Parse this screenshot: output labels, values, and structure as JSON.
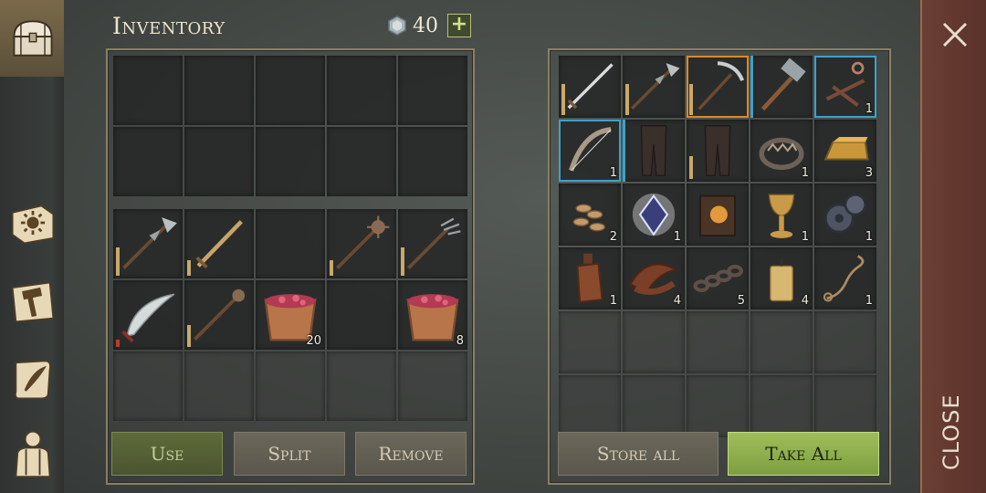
{
  "header": {
    "title": "Inventory",
    "currency_amount": "40",
    "add_label": "+"
  },
  "sidebar": {
    "tabs": [
      {
        "name": "inventory",
        "icon": "chest-icon",
        "active": true
      },
      {
        "name": "skills",
        "icon": "sun-book-icon"
      },
      {
        "name": "crafting",
        "icon": "hammer-map-icon"
      },
      {
        "name": "journal",
        "icon": "scroll-quill-icon"
      },
      {
        "name": "character",
        "icon": "backpack-character-icon"
      }
    ]
  },
  "inventory": {
    "slots": [
      {
        "item": "halberd",
        "icon": "halberd-icon",
        "durability": 0.45
      },
      {
        "item": "sword",
        "icon": "sword-icon",
        "durability": 0.25
      },
      {
        "item": "",
        "icon": ""
      },
      {
        "item": "mace",
        "icon": "spiked-mace-icon",
        "durability": 0.25
      },
      {
        "item": "pitchfork",
        "icon": "pitchfork-icon",
        "durability": 0.45
      },
      {
        "item": "scimitar",
        "icon": "scimitar-icon",
        "durability": 0.12,
        "low": true
      },
      {
        "item": "spear mace",
        "icon": "spear-mace-icon",
        "durability": 0.35
      },
      {
        "item": "berry bucket",
        "icon": "berry-bucket-icon",
        "qty": "20"
      },
      {
        "item": "",
        "icon": ""
      },
      {
        "item": "berry bucket",
        "icon": "berry-bucket-icon",
        "qty": "8"
      }
    ],
    "buttons": {
      "use": "Use",
      "split": "Split",
      "remove": "Remove"
    }
  },
  "storage": {
    "slots": [
      {
        "item": "longsword",
        "icon": "longsword-icon",
        "durability": 0.55
      },
      {
        "item": "halberd",
        "icon": "halberd-icon",
        "durability": 0.55
      },
      {
        "item": "pickaxe",
        "icon": "pickaxe-icon",
        "durability": 0.55,
        "highlight": "orange"
      },
      {
        "item": "sledgehammer",
        "icon": "hammer-icon",
        "highlight": "blue-left"
      },
      {
        "item": "crossbow frame",
        "icon": "crossbow-frame-icon",
        "qty": "1",
        "highlight": "blue"
      },
      {
        "item": "bow",
        "icon": "bow-icon",
        "qty": "1",
        "highlight": "blue"
      },
      {
        "item": "leather pants",
        "icon": "leather-pants-icon",
        "highlight": "blue-left"
      },
      {
        "item": "leather pants",
        "icon": "leather-pants-icon",
        "durability": 0.4
      },
      {
        "item": "bear trap",
        "icon": "bear-trap-icon",
        "qty": "1"
      },
      {
        "item": "gold ingot",
        "icon": "gold-ingot-icon",
        "qty": "3"
      },
      {
        "item": "seeds",
        "icon": "seeds-icon",
        "qty": "2"
      },
      {
        "item": "crystal",
        "icon": "crystal-icon",
        "qty": "1"
      },
      {
        "item": "book",
        "icon": "book-icon"
      },
      {
        "item": "chalice",
        "icon": "chalice-icon",
        "qty": "1"
      },
      {
        "item": "gears",
        "icon": "gears-icon",
        "qty": "1"
      },
      {
        "item": "leather flask",
        "icon": "flask-icon",
        "qty": "1"
      },
      {
        "item": "leather belt",
        "icon": "leather-belt-icon",
        "qty": "4"
      },
      {
        "item": "chain",
        "icon": "chain-icon",
        "qty": "5"
      },
      {
        "item": "candle",
        "icon": "candle-icon",
        "qty": "4"
      },
      {
        "item": "rope",
        "icon": "rope-icon",
        "qty": "1"
      }
    ],
    "buttons": {
      "store_all": "Store all",
      "take_all": "Take All"
    }
  },
  "close": {
    "label": "CLOSE"
  },
  "colors": {
    "accent_green": "#9fbe5a",
    "close_bg": "#6b3f34",
    "highlight_orange": "#d98a2b",
    "highlight_blue": "#3fa0c9"
  }
}
